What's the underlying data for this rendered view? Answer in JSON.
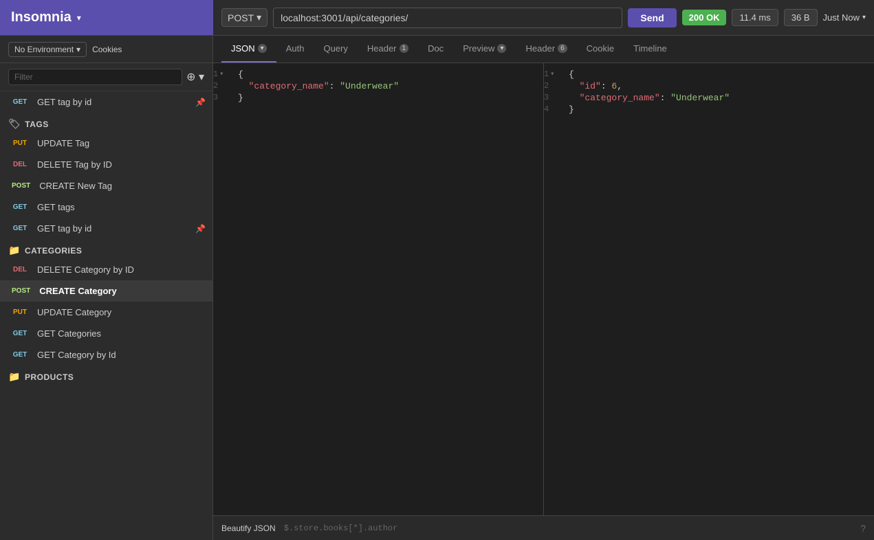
{
  "app": {
    "name": "Insomnia"
  },
  "topbar": {
    "method": "POST",
    "url": "localhost:3001/api/categories/",
    "send_label": "Send",
    "status": "200 OK",
    "time": "11.4 ms",
    "size": "36 B",
    "timestamp": "Just Now"
  },
  "tabs_left": {
    "env": "No Environment",
    "cookies": "Cookies"
  },
  "tabs_right": [
    {
      "label": "JSON",
      "active": true,
      "badge": null
    },
    {
      "label": "Auth",
      "active": false,
      "badge": null
    },
    {
      "label": "Query",
      "active": false,
      "badge": null
    },
    {
      "label": "Header",
      "active": false,
      "badge": "1"
    },
    {
      "label": "Doc",
      "active": false,
      "badge": null
    },
    {
      "label": "Preview",
      "active": false,
      "badge": null
    },
    {
      "label": "Header",
      "active": false,
      "badge": "6"
    },
    {
      "label": "Cookie",
      "active": false,
      "badge": null
    },
    {
      "label": "Timeline",
      "active": false,
      "badge": null
    }
  ],
  "filter_placeholder": "Filter",
  "sidebar": {
    "pinned_item": {
      "method": "GET",
      "label": "GET tag by id",
      "pinned": true
    },
    "folders": [
      {
        "name": "TAGS",
        "items": [
          {
            "method": "PUT",
            "label": "UPDATE Tag"
          },
          {
            "method": "DEL",
            "label": "DELETE Tag by ID"
          },
          {
            "method": "POST",
            "label": "CREATE New Tag"
          },
          {
            "method": "GET",
            "label": "GET tags"
          },
          {
            "method": "GET",
            "label": "GET tag by id",
            "pinned": true
          }
        ]
      },
      {
        "name": "CATEGORIES",
        "items": [
          {
            "method": "DEL",
            "label": "DELETE Category by ID"
          },
          {
            "method": "POST",
            "label": "CREATE Category",
            "active": true
          },
          {
            "method": "PUT",
            "label": "UPDATE Category"
          },
          {
            "method": "GET",
            "label": "GET Categories"
          },
          {
            "method": "GET",
            "label": "GET Category by Id"
          }
        ]
      },
      {
        "name": "PRODUCTS",
        "items": []
      }
    ]
  },
  "editor": {
    "lines": [
      {
        "num": "1",
        "arrow": "▾",
        "text": "{"
      },
      {
        "num": "2",
        "text": "  \"category_name\": \"Underwear\""
      },
      {
        "num": "3",
        "text": "}"
      }
    ]
  },
  "preview": {
    "lines": [
      {
        "num": "1",
        "arrow": "▾",
        "text": "{",
        "parts": [
          {
            "type": "brace",
            "val": "{"
          }
        ]
      },
      {
        "num": "2",
        "text": "  \"id\": 6,",
        "parts": [
          {
            "type": "key",
            "val": "  \"id\""
          },
          {
            "type": "colon",
            "val": ": "
          },
          {
            "type": "number",
            "val": "6"
          },
          {
            "type": "comma",
            "val": ","
          }
        ]
      },
      {
        "num": "3",
        "text": "  \"category_name\": \"Underwear\"",
        "parts": [
          {
            "type": "key",
            "val": "  \"category_name\""
          },
          {
            "type": "colon",
            "val": ": "
          },
          {
            "type": "string",
            "val": "\"Underwear\""
          }
        ]
      },
      {
        "num": "4",
        "text": "}",
        "parts": [
          {
            "type": "brace",
            "val": "}"
          }
        ]
      }
    ]
  },
  "bottom": {
    "beautify": "Beautify JSON",
    "jq": "$.store.books[*].author"
  }
}
